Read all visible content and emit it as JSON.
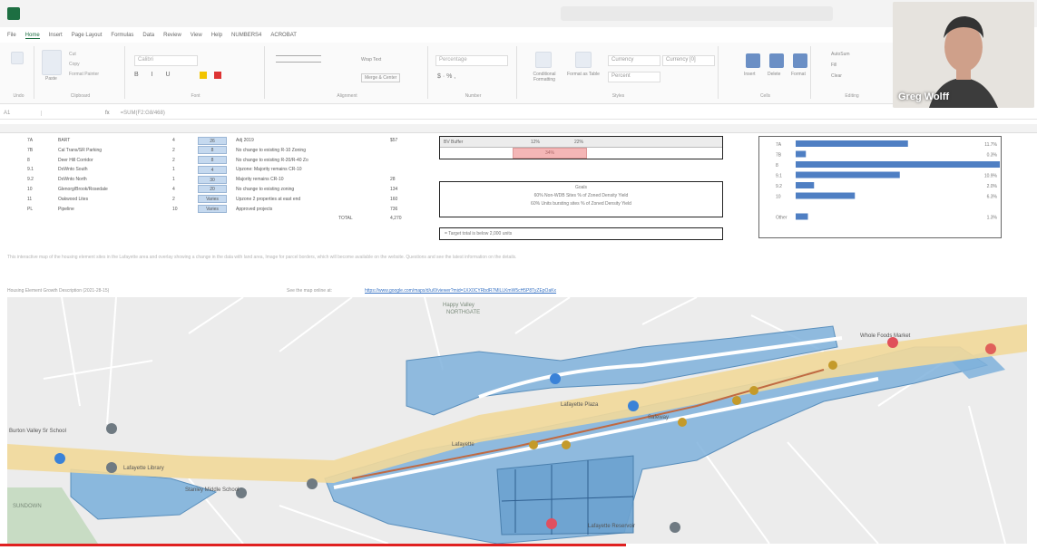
{
  "window": {
    "title": "",
    "search_placeholder": ""
  },
  "ribbon": {
    "tabs": [
      "File",
      "Home",
      "Insert",
      "Page Layout",
      "Formulas",
      "Data",
      "Review",
      "View",
      "Help",
      "NUMBERS4",
      "ACROBAT"
    ],
    "active_tab": "Home",
    "groups": [
      "Undo",
      "Clipboard",
      "Font",
      "Alignment",
      "Number",
      "Styles",
      "Cells",
      "Editing"
    ],
    "paste_label": "Paste",
    "cut_label": "Cut",
    "copy_label": "Copy",
    "format_painter_label": "Format Painter",
    "font_name": "Calibri",
    "wrap_text_label": "Wrap Text",
    "merge_label": "Merge & Center",
    "number_format": "Percentage",
    "conditional_label": "Conditional Formatting",
    "format_table_label": "Format as Table",
    "style_currency": "Currency",
    "style_currency0": "Currency [0]",
    "style_percent": "Percent",
    "insert_label": "Insert",
    "delete_label": "Delete",
    "format_label": "Format",
    "autosum_label": "AutoSum",
    "fill_label": "Fill",
    "clear_label": "Clear",
    "editing_label": "Editing"
  },
  "formula_bar": {
    "namebox": "A1",
    "fx": "fx",
    "formula": "=SUM(F2:G8/468)"
  },
  "table": {
    "rows": [
      {
        "id": "7A",
        "name": "BART",
        "n": "4",
        "tag": "26",
        "desc": "Adj 2019",
        "val": "$57"
      },
      {
        "id": "7B",
        "name": "Cal Trans/SR Parking",
        "n": "2",
        "tag": "8",
        "desc": "No change to existing R-10 Zoning",
        "val": ""
      },
      {
        "id": "8",
        "name": "Deer Hill Corridor",
        "n": "2",
        "tag": "8",
        "desc": "No change to existing R-20/R-40 Zo",
        "val": ""
      },
      {
        "id": "9.1",
        "name": "DoWnto South",
        "n": "1",
        "tag": "4",
        "desc": "Upzone: Majority remains CR-10",
        "val": ""
      },
      {
        "id": "9.2",
        "name": "DoWnto North",
        "n": "1",
        "tag": "30",
        "desc": "Majority remains CR-10",
        "val": "28"
      },
      {
        "id": "10",
        "name": "Glenorg/Brook/Rosedale",
        "n": "4",
        "tag": "20",
        "desc": "No change to existing zoning",
        "val": "134"
      },
      {
        "id": "11",
        "name": "Oakwood Lites",
        "n": "2",
        "tag": "Varies",
        "desc": "Upzone 2 properties at east end",
        "val": "160"
      },
      {
        "id": "PL",
        "name": "Pipeline",
        "n": "10",
        "tag": "Varies",
        "desc": "Approved projects",
        "val": "736"
      }
    ],
    "total_label": "TOTAL",
    "total_value": "4,270"
  },
  "mid": {
    "row_label": "BV Buffer",
    "row_vals": [
      "12%",
      "22%"
    ],
    "pink_val": "34%",
    "goals_title": "Goals",
    "goal1": "60% Non-WDB Sites % of Zoned Density Yield",
    "goal2": "60% Units bursting sites % of Zoned Density Yield",
    "footer": "= Target total is below 2,000 units"
  },
  "chart_data": {
    "type": "bar",
    "categories": [
      "7A",
      "7B",
      "8",
      "9.1",
      "9.2",
      "10",
      "",
      "Other"
    ],
    "values": [
      0.55,
      0.05,
      1.0,
      0.51,
      0.09,
      0.29,
      0,
      0.06
    ],
    "value_labels": [
      "11.7%",
      "0.3%",
      "",
      "10.9%",
      "2.0%",
      "6.3%",
      "",
      "1.3%"
    ],
    "title": "",
    "xlabel": "",
    "ylabel": ""
  },
  "notes": {
    "note1": "This interactive map of the housing element sites in the Lafayette area and overlay showing a change in the data with land area, Image for parcel borders, which will become available on the website. Questions and see the latest information on the details.",
    "note2": "Housing Element Growth Description (2021-28-15)",
    "note3": "See the map online at:",
    "link": "https://www.google.com/maps/d/u/0/viewer?mid=1XX0CYRbdR7MlLLKmW5cH5P8TyZEpOaKx"
  },
  "map": {
    "labels": {
      "area_northgate": "NORTHGATE",
      "area_valley": "Happy Valley",
      "poi1": "Burton Valley Sr School",
      "poi2": "Lafayette Plaza",
      "poi3": "Lafayette Library",
      "poi4": "Stanley Middle School",
      "poi5": "Lafayette Reservoir",
      "poi6": "Whole Foods Market",
      "poi7": "Safeway",
      "town": "Lafayette",
      "area_bottom": "SUNDOWN"
    }
  },
  "webcam": {
    "name": "Greg Wolff"
  }
}
